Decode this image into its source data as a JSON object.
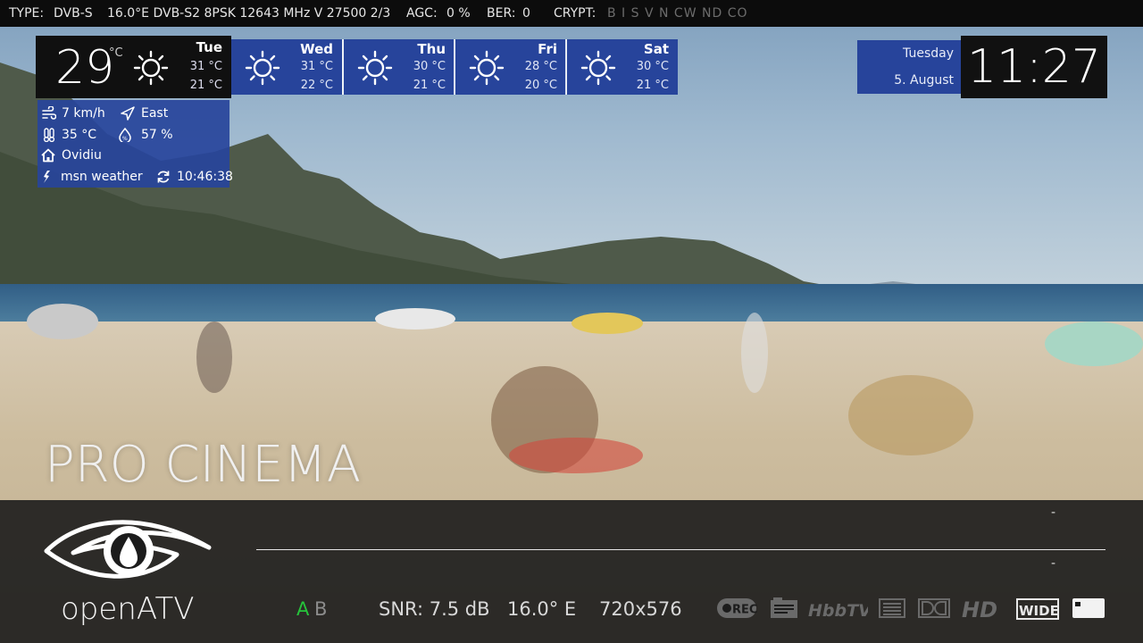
{
  "topbar": {
    "type_label": "TYPE:",
    "type_value": "DVB-S",
    "transponder": "16.0°E DVB-S2 8PSK 12643 MHz V 27500 2/3",
    "agc_label": "AGC:",
    "agc_value": "0 %",
    "ber_label": "BER:",
    "ber_value": "0",
    "crypt_label": "CRYPT:",
    "crypt_systems": "B  I  S  V  N  CW  ND  CO"
  },
  "weather": {
    "current": {
      "temp": "29",
      "unit": "°C",
      "icon": "sun-icon",
      "day": "Tue",
      "high": "31 °C",
      "low": "21 °C"
    },
    "forecast": [
      {
        "day": "Wed",
        "high": "31 °C",
        "low": "22 °C",
        "icon": "sun-icon"
      },
      {
        "day": "Thu",
        "high": "30 °C",
        "low": "21 °C",
        "icon": "sun-icon"
      },
      {
        "day": "Fri",
        "high": "28 °C",
        "low": "20 °C",
        "icon": "sun-icon"
      },
      {
        "day": "Sat",
        "high": "30 °C",
        "low": "21 °C",
        "icon": "sun-icon"
      }
    ],
    "details": {
      "wind_speed": "7 km/h",
      "wind_direction": "East",
      "feels_like": "35 °C",
      "humidity": "57 %",
      "location": "Ovidiu",
      "provider": "msn weather",
      "updated": "10:46:38"
    }
  },
  "datetime": {
    "weekday": "Tuesday",
    "date": "5. August",
    "time": "11:27"
  },
  "channel": {
    "name": "PRO CINEMA"
  },
  "infobar": {
    "logo_text": "openATV",
    "now_event": "-",
    "next_event": "-",
    "progress": 0,
    "audio_a": "A",
    "audio_b": "B",
    "snr": "SNR: 7.5 dB",
    "orbital": "16.0° E",
    "resolution": "720x576",
    "rec_label": "REC",
    "hbbtv_label": "HbbTV",
    "hd_label": "HD",
    "wide_label": "WIDE"
  },
  "colors": {
    "panel_blue": "#27449b",
    "audio_active": "#26c43b"
  }
}
